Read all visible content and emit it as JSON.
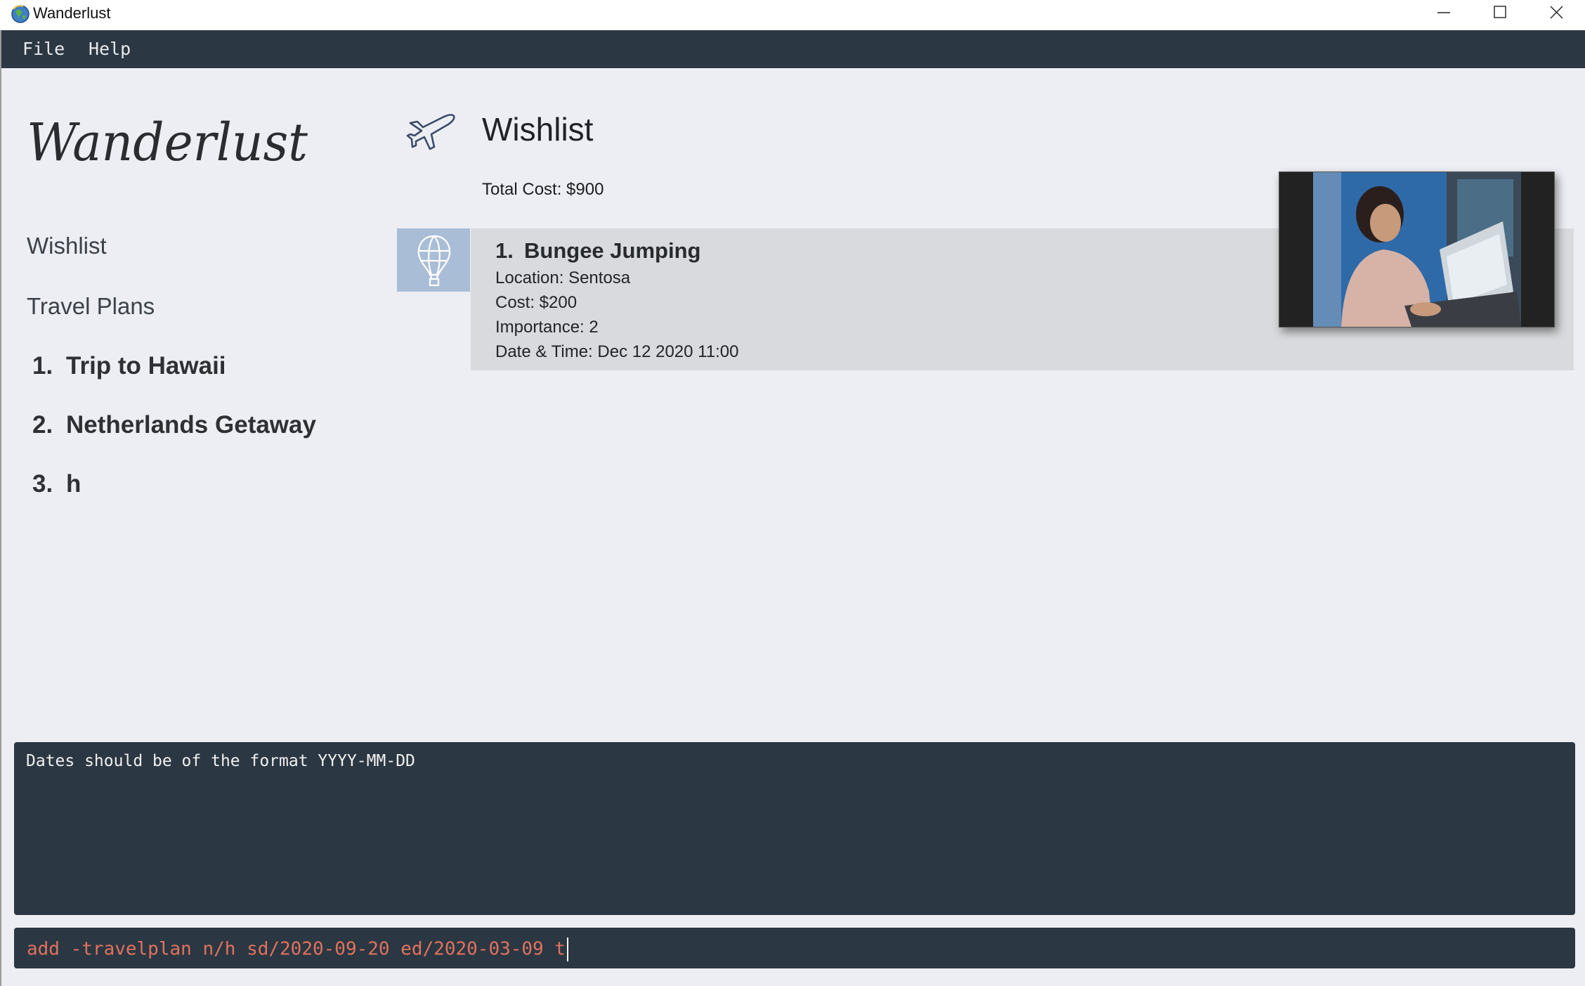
{
  "window": {
    "title": "Wanderlust",
    "minimize_icon": "minimize-icon",
    "maximize_icon": "maximize-icon",
    "close_icon": "close-icon"
  },
  "menu": {
    "items": [
      {
        "label": "File"
      },
      {
        "label": "Help"
      }
    ]
  },
  "sidebar": {
    "logo_text": "Wanderlust",
    "wishlist_label": "Wishlist",
    "travel_plans_label": "Travel Plans",
    "plans": [
      {
        "number": "1.",
        "name": "Trip to Hawaii"
      },
      {
        "number": "2.",
        "name": "Netherlands Getaway"
      },
      {
        "number": "3.",
        "name": "h"
      }
    ]
  },
  "content": {
    "section_icon": "airplane-icon",
    "section_title": "Wishlist",
    "total_cost": "Total Cost: $900",
    "activities": [
      {
        "icon": "hot-air-balloon-icon",
        "number": "1.",
        "name": "Bungee Jumping",
        "location": "Location: Sentosa",
        "cost": "Cost: $200",
        "importance": "Importance: 2",
        "datetime": "Date & Time: Dec 12 2020 11:00"
      }
    ]
  },
  "result_display": {
    "text": "Dates should be of the format YYYY-MM-DD"
  },
  "command_box": {
    "value": "add -travelplan n/h sd/2020-09-20 ed/2020-03-09 t"
  },
  "colors": {
    "menubar": "#2b3742",
    "background": "#edeef3",
    "card": "#d9dadd",
    "card_icon_box": "#a9bdd6",
    "command_text": "#e0735e"
  }
}
